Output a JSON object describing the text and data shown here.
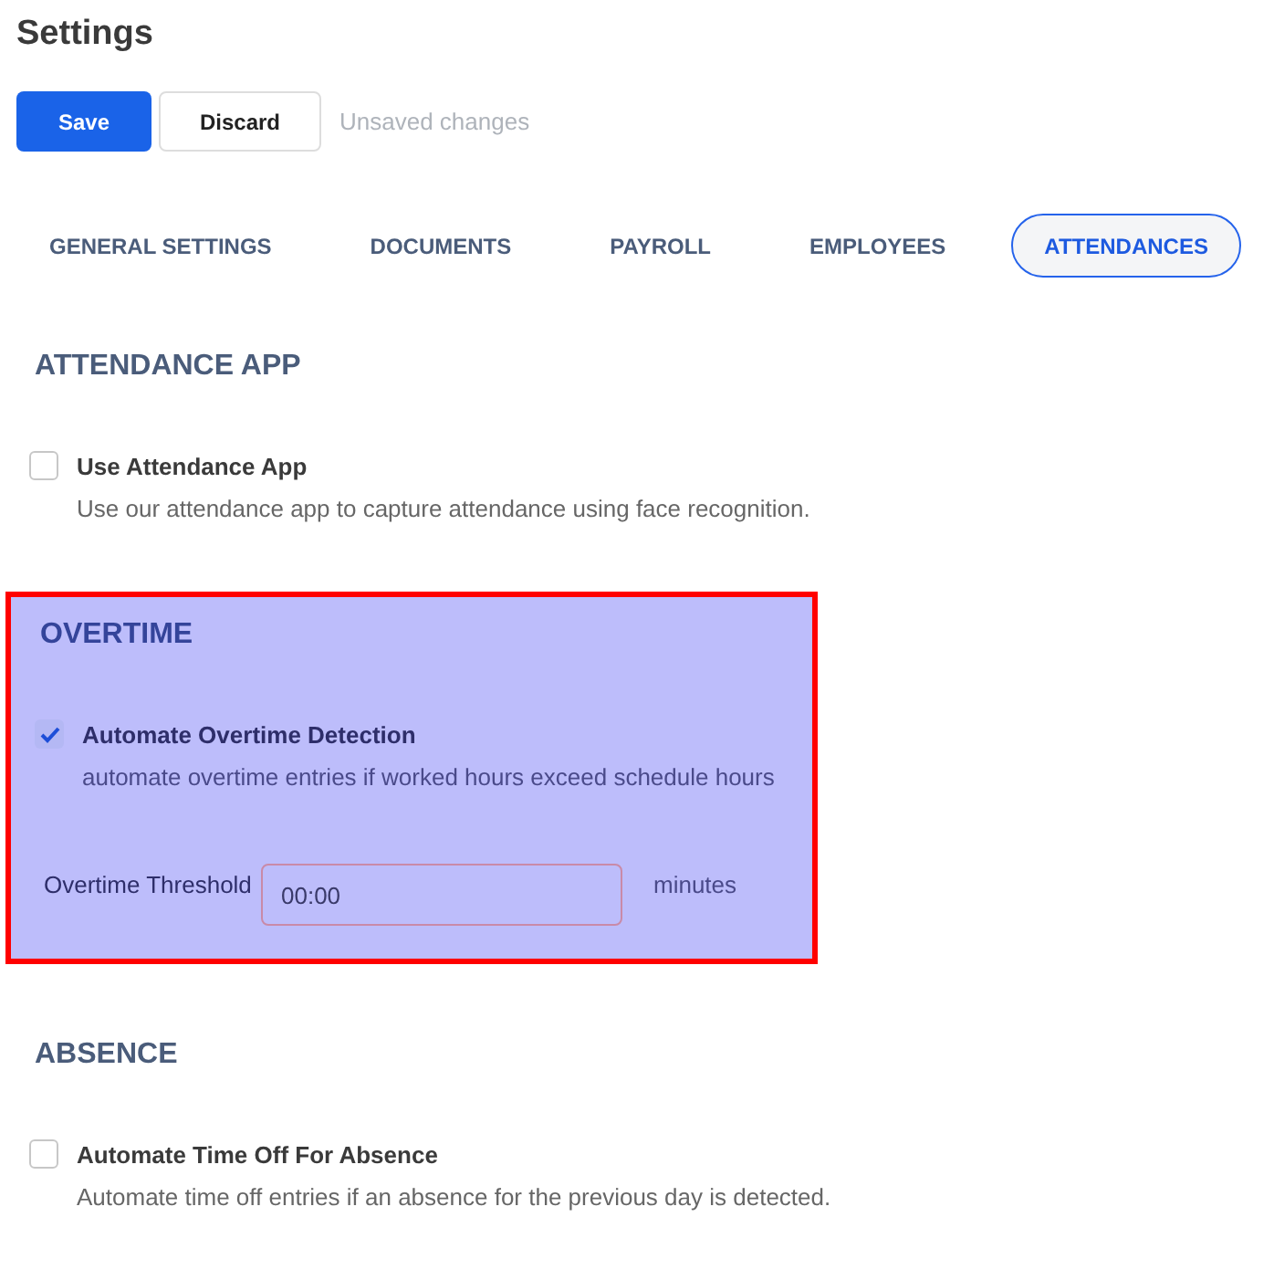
{
  "title": "Settings",
  "actions": {
    "save": "Save",
    "discard": "Discard",
    "status": "Unsaved changes"
  },
  "tabs": [
    {
      "label": "GENERAL SETTINGS",
      "selected": false
    },
    {
      "label": "DOCUMENTS",
      "selected": false
    },
    {
      "label": "PAYROLL",
      "selected": false
    },
    {
      "label": "EMPLOYEES",
      "selected": false
    },
    {
      "label": "ATTENDANCES",
      "selected": true
    }
  ],
  "sections": [
    {
      "heading": "ATTENDANCE APP",
      "highlighted": false,
      "items": [
        {
          "kind": "checkbox",
          "label": "Use Attendance App",
          "description": "Use our attendance app to capture attendance using face recognition.",
          "checked": false
        }
      ]
    },
    {
      "heading": "OVERTIME",
      "highlighted": true,
      "items": [
        {
          "kind": "checkbox",
          "label": "Automate Overtime Detection",
          "description": "automate overtime entries if worked hours exceed schedule hours",
          "checked": true
        },
        {
          "kind": "field",
          "label": "Overtime Threshold",
          "value": "00:00",
          "unit": "minutes"
        }
      ]
    },
    {
      "heading": "ABSENCE",
      "highlighted": false,
      "items": [
        {
          "kind": "checkbox",
          "label": "Automate Time Off For Absence",
          "description": "Automate time off entries if an absence for the previous day is detected.",
          "checked": false
        }
      ]
    }
  ]
}
